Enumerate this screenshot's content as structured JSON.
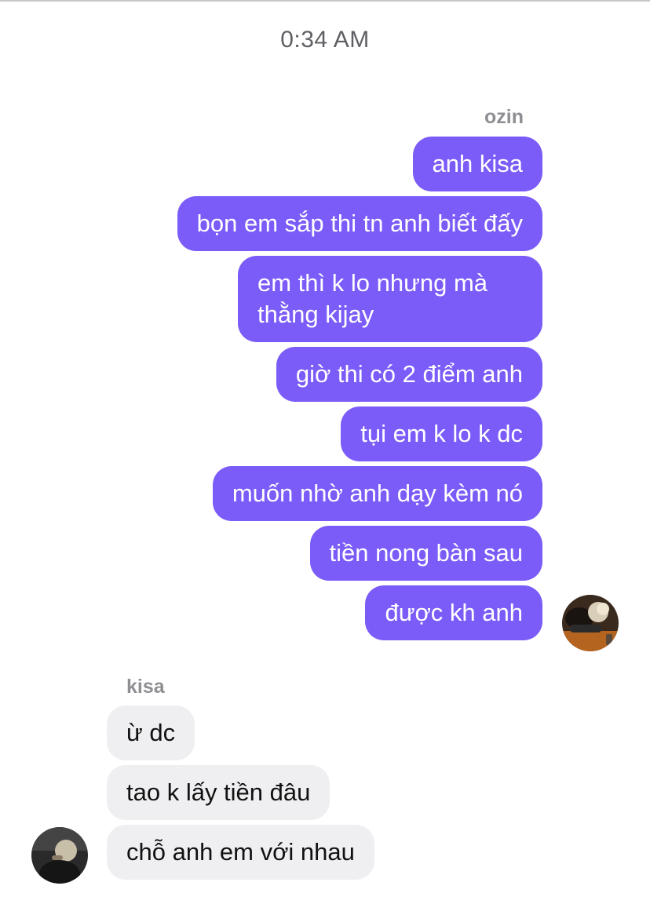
{
  "timestamp": "0:34 AM",
  "outgoing": {
    "sender": "ozin",
    "messages": [
      "anh kisa",
      "bọn em sắp thi tn anh biết đấy",
      "em thì k lo nhưng mà thằng kijay",
      "giờ thi có 2 điểm anh",
      "tụi em k lo k dc",
      "muốn nhờ anh dạy kèm nó",
      "tiền nong bàn sau",
      "được kh anh"
    ]
  },
  "incoming": {
    "sender": "kisa",
    "messages": [
      "ừ dc",
      "tao k lấy tiền đâu",
      "chỗ anh em với nhau"
    ]
  },
  "colors": {
    "outgoing_bubble": "#7b5cf8",
    "incoming_bubble": "#efeff2"
  }
}
